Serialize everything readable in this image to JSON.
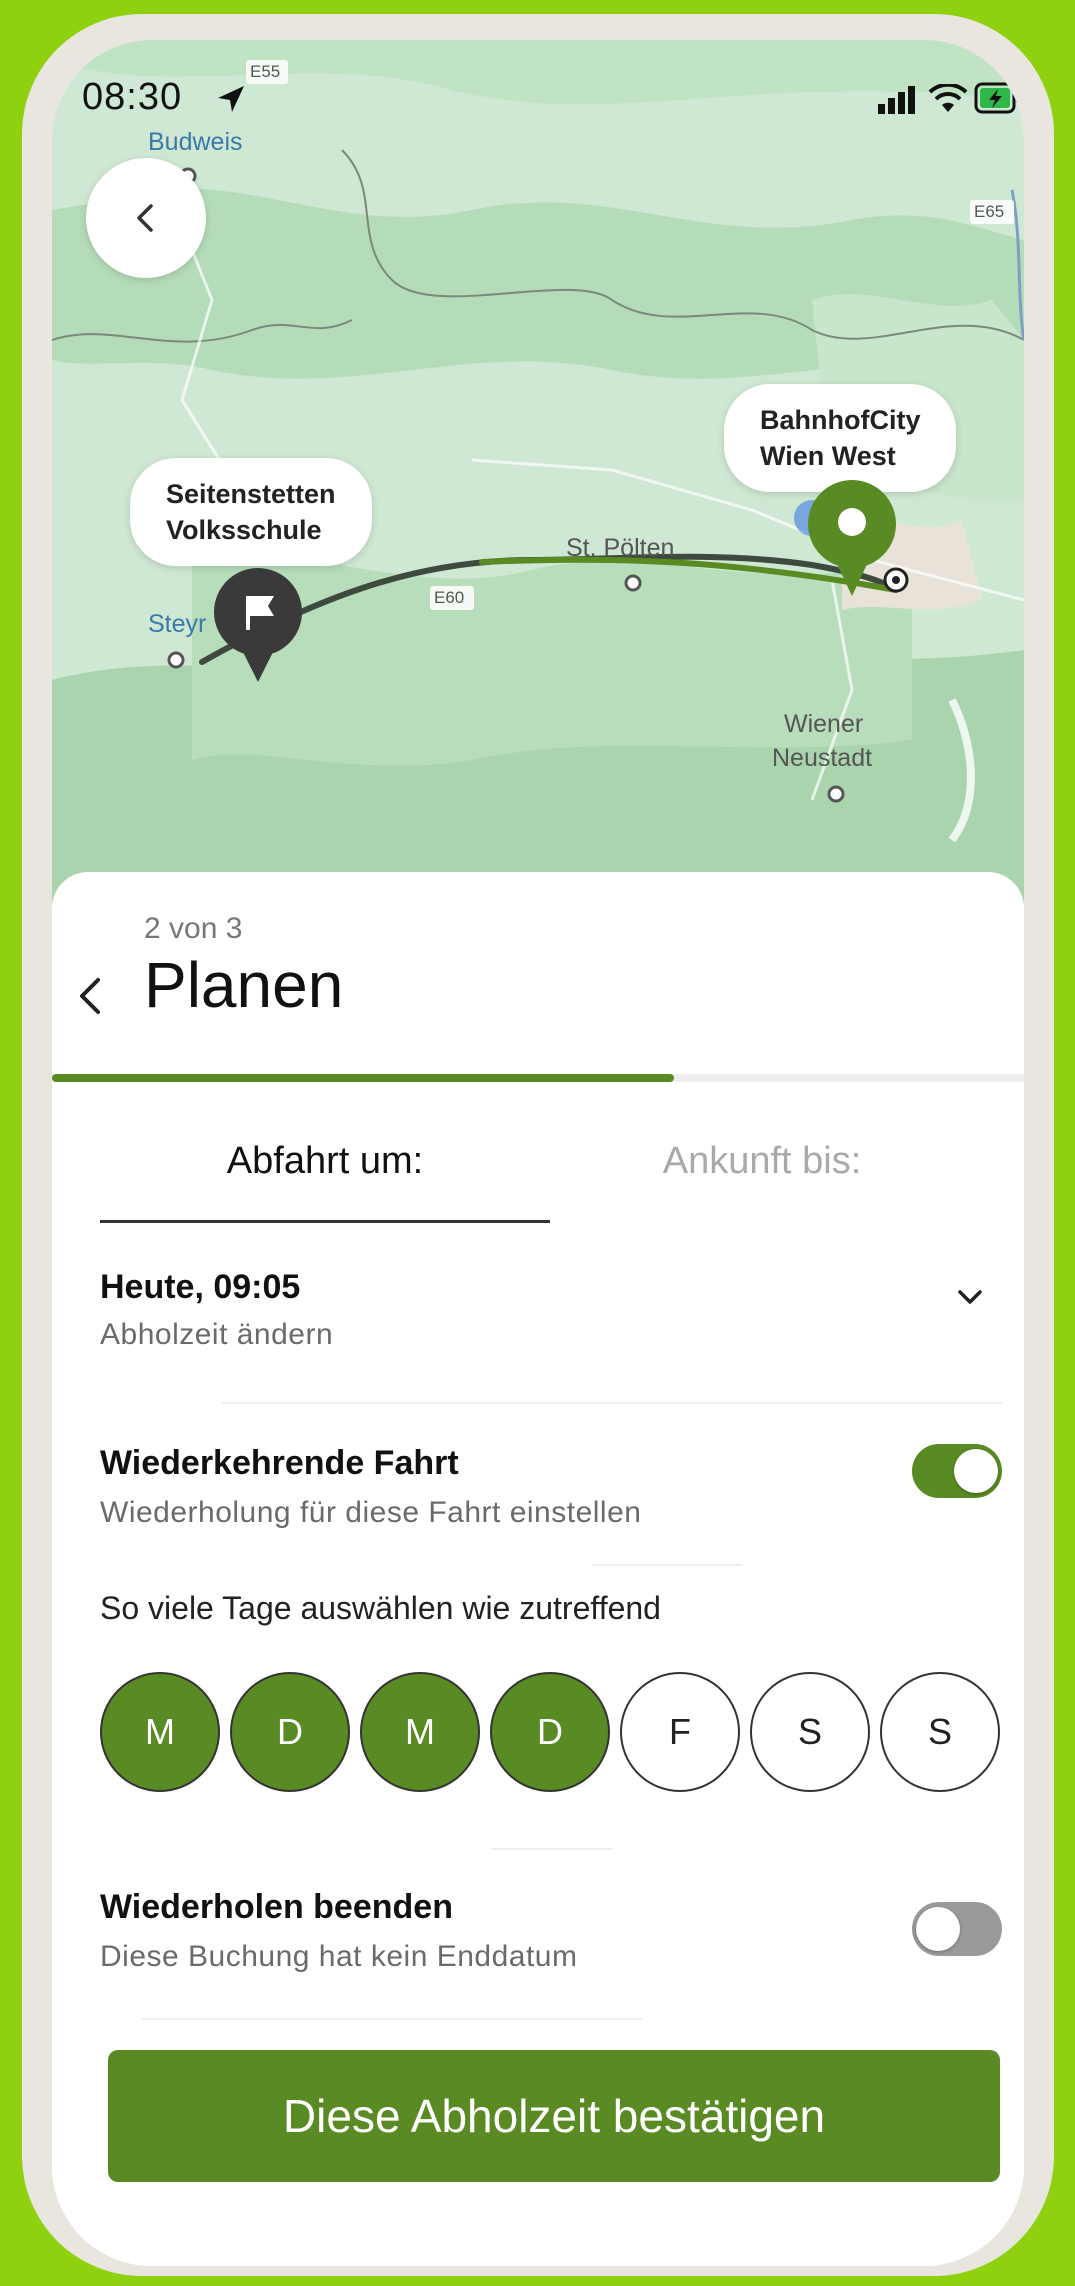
{
  "status_bar": {
    "time": "08:30"
  },
  "map": {
    "labels": {
      "budweis": "Budweis",
      "steyr": "Steyr",
      "st_poelten": "St. Pölten",
      "wiener_neustadt_1": "Wiener",
      "wiener_neustadt_2": "Neustadt",
      "e55": "E55",
      "e60": "E60",
      "e65": "E65"
    },
    "origin_line1": "Seitenstetten",
    "origin_line2": "Volksschule",
    "destination_line1": "BahnhofCity",
    "destination_line2": "Wien West"
  },
  "sheet": {
    "step": "2 von 3",
    "title": "Planen",
    "progress": 0.64,
    "tabs": {
      "departure": "Abfahrt um:",
      "arrival": "Ankunft bis:"
    },
    "pickup": {
      "time": "Heute, 09:05",
      "action": "Abholzeit ändern"
    },
    "recurring": {
      "title": "Wiederkehrende Fahrt",
      "subtitle": "Wiederholung für diese Fahrt einstellen",
      "enabled": true
    },
    "days_label": "So viele Tage auswählen wie zutreffend",
    "days": [
      "M",
      "D",
      "M",
      "D",
      "F",
      "S",
      "S"
    ],
    "days_selected": [
      true,
      true,
      true,
      true,
      false,
      false,
      false
    ],
    "end_repeat": {
      "title": "Wiederholen beenden",
      "subtitle": "Diese Buchung hat kein Enddatum",
      "enabled": false
    },
    "confirm_label": "Diese Abholzeit bestätigen"
  },
  "colors": {
    "accent": "#5a8a23",
    "background": "#8fd10f"
  }
}
